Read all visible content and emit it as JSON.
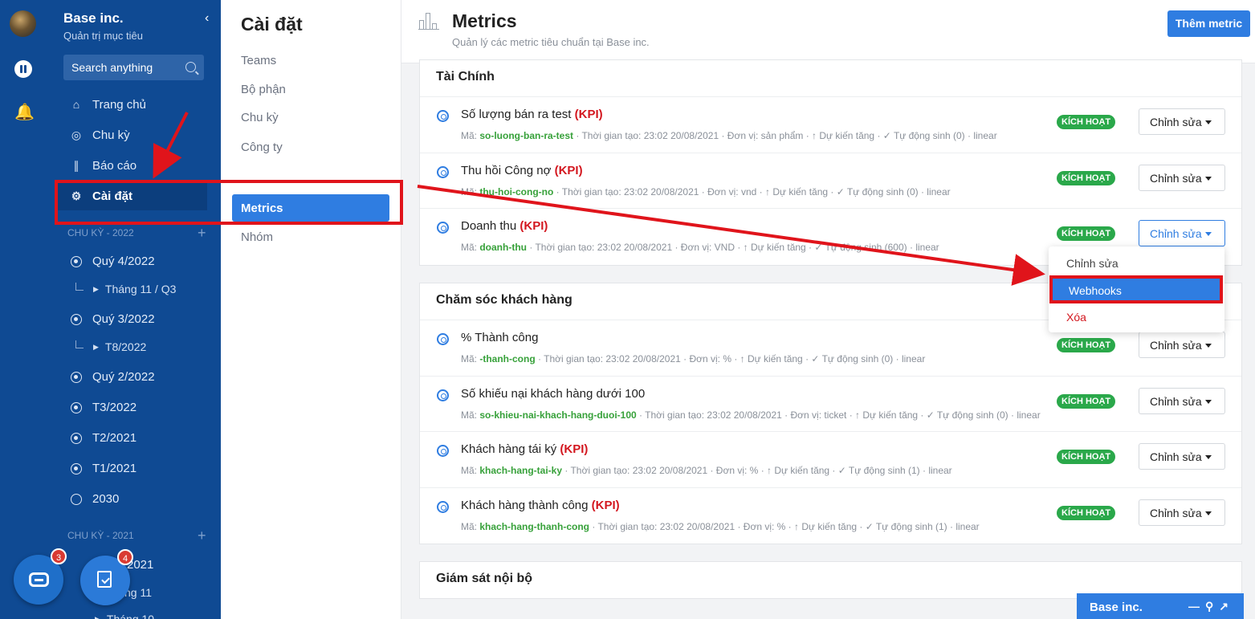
{
  "sidebar": {
    "org_name": "Base inc.",
    "org_subtitle": "Quản trị mục tiêu",
    "search_placeholder": "Search anything",
    "nav": [
      {
        "label": "Trang chủ",
        "icon": "home-icon"
      },
      {
        "label": "Chu kỳ",
        "icon": "cycle-icon"
      },
      {
        "label": "Báo cáo",
        "icon": "chart-icon"
      },
      {
        "label": "Cài đặt",
        "icon": "gear-icon"
      }
    ],
    "section_2022": "CHU KỲ - 2022",
    "cycles_2022": [
      {
        "label": "Quý 4/2022",
        "sub": "Tháng 11 / Q3"
      },
      {
        "label": "Quý 3/2022",
        "sub": "T8/2022"
      },
      {
        "label": "Quý 2/2022"
      },
      {
        "label": "T3/2022"
      },
      {
        "label": "T2/2021"
      },
      {
        "label": "T1/2021"
      },
      {
        "label": "2030"
      }
    ],
    "section_2021": "CHU KỲ - 2021",
    "cycles_2021_partial": [
      "2021",
      "ng 11",
      "Tháng 10"
    ],
    "fab_chat_badge": "3",
    "fab_task_badge": "4"
  },
  "settings": {
    "title": "Cài đặt",
    "items": [
      "Teams",
      "Bộ phận",
      "Chu kỳ",
      "Công ty",
      "Metrics",
      "Nhóm"
    ]
  },
  "header": {
    "title": "Metrics",
    "subtitle": "Quản lý các metric tiêu chuẩn tại Base inc.",
    "add_button": "Thêm metric"
  },
  "status_label": "KÍCH HOẠT",
  "edit_label": "Chỉnh sửa",
  "groups": [
    {
      "title": "Tài Chính",
      "rows": [
        {
          "name": "Số lượng bán ra test",
          "kpi": "(KPI)",
          "code_prefix": "Mã: ",
          "code": "so-luong-ban-ra-test",
          "meta": " · Thời gian tạo: 23:02 20/08/2021 · Đơn vị: sản phẩm · ↑ Dự kiến tăng · ✓ Tự động sinh (0) · linear"
        },
        {
          "name": "Thu hồi Công nợ",
          "kpi": "(KPI)",
          "code_prefix": "Mã: ",
          "code": "thu-hoi-cong-no",
          "meta": " · Thời gian tạo: 23:02 20/08/2021 · Đơn vị: vnd · ↑ Dự kiến tăng · ✓ Tự động sinh (0) · linear"
        },
        {
          "name": "Doanh thu",
          "kpi": "(KPI)",
          "code_prefix": "Mã: ",
          "code": "doanh-thu",
          "meta": " · Thời gian tạo: 23:02 20/08/2021 · Đơn vị: VND · ↑ Dự kiến tăng · ✓ Tự động sinh (600) · linear"
        }
      ]
    },
    {
      "title": "Chăm sóc khách hàng",
      "rows": [
        {
          "name": "% Thành công",
          "kpi": "",
          "code_prefix": "Mã: ",
          "code": "-thanh-cong",
          "meta": " · Thời gian tạo: 23:02 20/08/2021 · Đơn vị: % · ↑ Dự kiến tăng · ✓ Tự động sinh (0) · linear"
        },
        {
          "name": "Số khiếu nại khách hàng dưới 100",
          "kpi": "",
          "code_prefix": "Mã: ",
          "code": "so-khieu-nai-khach-hang-duoi-100",
          "meta": " · Thời gian tạo: 23:02 20/08/2021 · Đơn vị: ticket · ↑ Dự kiến tăng · ✓ Tự động sinh (0) · linear"
        },
        {
          "name": "Khách hàng tái ký",
          "kpi": "(KPI)",
          "code_prefix": "Mã: ",
          "code": "khach-hang-tai-ky",
          "meta": " · Thời gian tạo: 23:02 20/08/2021 · Đơn vị: % · ↑ Dự kiến tăng · ✓ Tự động sinh (1) · linear"
        },
        {
          "name": "Khách hàng thành công",
          "kpi": "(KPI)",
          "code_prefix": "Mã: ",
          "code": "khach-hang-thanh-cong",
          "meta": " · Thời gian tạo: 23:02 20/08/2021 · Đơn vị: % · ↑ Dự kiến tăng · ✓ Tự động sinh (1) · linear"
        }
      ]
    },
    {
      "title": "Giám sát nội bộ",
      "rows": []
    }
  ],
  "dropdown": [
    "Chỉnh sửa",
    "Webhooks",
    "Xóa"
  ],
  "chat_bar": {
    "title": "Base inc."
  },
  "colors": {
    "sidebar": "#0f4a93",
    "accent": "#2f7de1",
    "kpi": "#d3171f",
    "active_badge": "#2aa84a",
    "annotation": "#e0141b"
  }
}
